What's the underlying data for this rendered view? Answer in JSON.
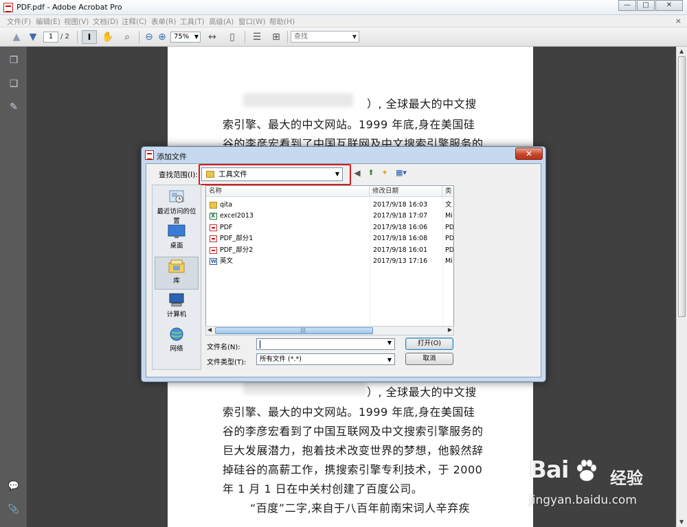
{
  "window": {
    "title": "PDF.pdf - Adobe Acrobat Pro",
    "min_glyph": "—",
    "max_glyph": "□",
    "close_glyph": "✕"
  },
  "menu": {
    "items": [
      "文件(F)",
      "编辑(E)",
      "视图(V)",
      "文档(D)",
      "注释(C)",
      "表单(R)",
      "工具(T)",
      "高级(A)",
      "窗口(W)",
      "帮助(H)"
    ],
    "close_glyph": "×"
  },
  "toolbar": {
    "page_current": "1",
    "page_total": "/ 2",
    "zoom": "75%",
    "find_placeholder": "查找",
    "select_glyph": "I"
  },
  "document": {
    "lines_top": [
      "）, 全球最大的中文搜",
      "索引擎、最大的中文网站。1999 年底,身在美国硅",
      "谷的李彦宏看到了中国互联网及中文搜索引擎服务的"
    ],
    "lines_bottom": [
      "）, 全球最大的中文搜",
      "索引擎、最大的中文网站。1999 年底,身在美国硅",
      "谷的李彦宏看到了中国互联网及中文搜索引擎服务的",
      "巨大发展潜力，抱着技术改变世界的梦想，他毅然辞",
      "掉硅谷的高薪工作，携搜索引擎专利技术，于 2000",
      "年 1 月 1 日在中关村创建了百度公司。",
      "“百度”二字,来自于八百年前南宋词人辛弃疾"
    ]
  },
  "dialog": {
    "title": "添加文件",
    "lookin_label": "查找范围(I):",
    "lookin_value": "工具文件",
    "places": [
      {
        "label": "最近访问的位置",
        "icon": "recent-places-icon"
      },
      {
        "label": "桌面",
        "icon": "desktop-icon"
      },
      {
        "label": "库",
        "icon": "library-icon"
      },
      {
        "label": "计算机",
        "icon": "computer-icon"
      },
      {
        "label": "网络",
        "icon": "network-icon"
      }
    ],
    "columns": [
      "名称",
      "修改日期",
      "类"
    ],
    "files": [
      {
        "name": "qita",
        "date": "2017/9/18 16:03",
        "type": "文",
        "kind": "folder"
      },
      {
        "name": "excel2013",
        "date": "2017/9/18 17:07",
        "type": "Mi",
        "kind": "xls"
      },
      {
        "name": "PDF",
        "date": "2017/9/18 16:06",
        "type": "PD",
        "kind": "pdf"
      },
      {
        "name": "PDF_部分1",
        "date": "2017/9/18 16:08",
        "type": "PD",
        "kind": "pdf"
      },
      {
        "name": "PDF_部分2",
        "date": "2017/9/18 16:01",
        "type": "PD",
        "kind": "pdf"
      },
      {
        "name": "英文",
        "date": "2017/9/13 17:16",
        "type": "Mi",
        "kind": "doc"
      }
    ],
    "filename_label": "文件名(N):",
    "filename_value": "",
    "filetype_label": "文件类型(T):",
    "filetype_value": "所有文件 (*.*)",
    "open_button": "打开(O)",
    "cancel_button": "取消",
    "close_glyph": "✕"
  },
  "watermark": {
    "brand": "Bai",
    "brand_suffix": "经验",
    "url": "jingyan.baidu.com"
  }
}
